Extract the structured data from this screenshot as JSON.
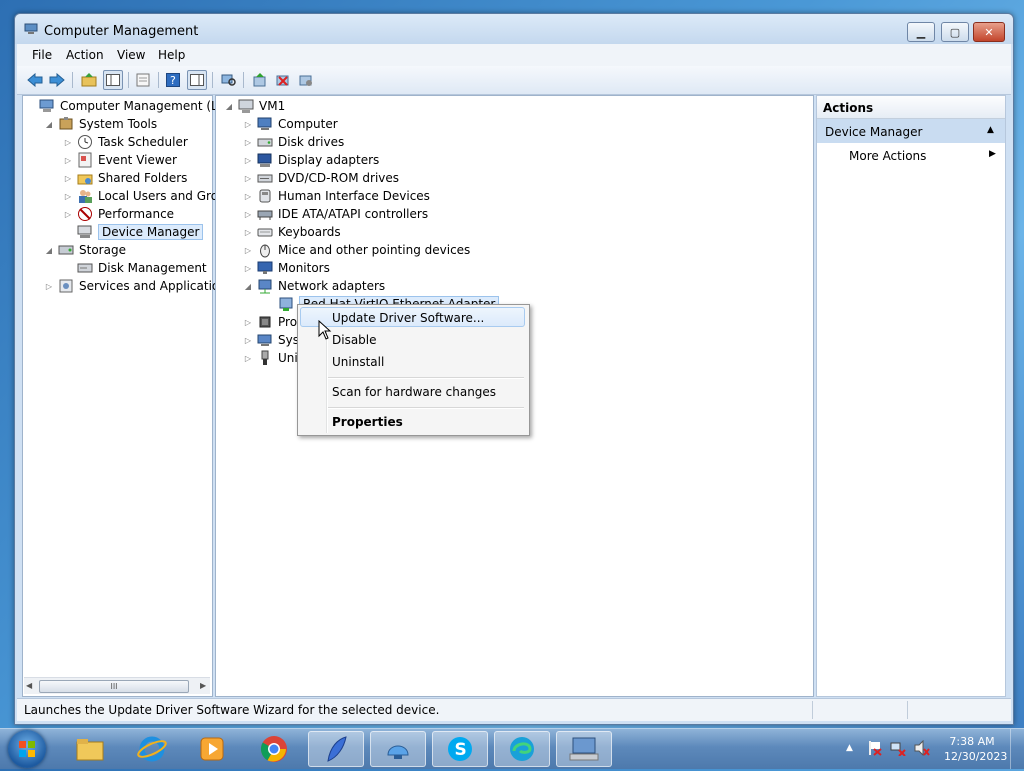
{
  "window": {
    "title": "Computer Management",
    "buttons": {
      "minimize": "▁",
      "maximize": "▢",
      "close": "✕"
    }
  },
  "menu": [
    "File",
    "Action",
    "View",
    "Help"
  ],
  "toolbar_icons": [
    "back-icon",
    "forward-icon",
    "up-folder-icon",
    "show-hide-tree-icon",
    "properties-icon",
    "help-icon",
    "show-hide-action-pane-icon",
    "scan-hardware-icon",
    "update-driver-icon",
    "uninstall-icon",
    "disable-icon"
  ],
  "left_tree": [
    {
      "label": "Computer Management (Local",
      "depth": 0,
      "expander": "",
      "icon": "computer-management-icon"
    },
    {
      "label": "System Tools",
      "depth": 1,
      "expander": "◢",
      "icon": "system-tools-icon"
    },
    {
      "label": "Task Scheduler",
      "depth": 2,
      "expander": "▷",
      "icon": "clock-icon"
    },
    {
      "label": "Event Viewer",
      "depth": 2,
      "expander": "▷",
      "icon": "event-viewer-icon"
    },
    {
      "label": "Shared Folders",
      "depth": 2,
      "expander": "▷",
      "icon": "shared-folder-icon"
    },
    {
      "label": "Local Users and Groups",
      "depth": 2,
      "expander": "▷",
      "icon": "users-icon"
    },
    {
      "label": "Performance",
      "depth": 2,
      "expander": "▷",
      "icon": "performance-icon"
    },
    {
      "label": "Device Manager",
      "depth": 2,
      "expander": "",
      "icon": "device-manager-icon",
      "selected": true
    },
    {
      "label": "Storage",
      "depth": 1,
      "expander": "◢",
      "icon": "storage-icon"
    },
    {
      "label": "Disk Management",
      "depth": 2,
      "expander": "",
      "icon": "disk-management-icon"
    },
    {
      "label": "Services and Applications",
      "depth": 1,
      "expander": "▷",
      "icon": "services-icon"
    }
  ],
  "left_scrollbar": {
    "grip": "III"
  },
  "device_tree": {
    "root": "VM1",
    "items": [
      {
        "label": "Computer",
        "expander": "▷",
        "icon": "computer-icon"
      },
      {
        "label": "Disk drives",
        "expander": "▷",
        "icon": "disk-drive-icon"
      },
      {
        "label": "Display adapters",
        "expander": "▷",
        "icon": "display-adapter-icon"
      },
      {
        "label": "DVD/CD-ROM drives",
        "expander": "▷",
        "icon": "dvd-drive-icon"
      },
      {
        "label": "Human Interface Devices",
        "expander": "▷",
        "icon": "hid-icon"
      },
      {
        "label": "IDE ATA/ATAPI controllers",
        "expander": "▷",
        "icon": "ide-controller-icon"
      },
      {
        "label": "Keyboards",
        "expander": "▷",
        "icon": "keyboard-icon"
      },
      {
        "label": "Mice and other pointing devices",
        "expander": "▷",
        "icon": "mouse-icon"
      },
      {
        "label": "Monitors",
        "expander": "▷",
        "icon": "monitor-icon"
      },
      {
        "label": "Network adapters",
        "expander": "◢",
        "icon": "network-adapter-icon"
      },
      {
        "label": "Red Hat VirtIO Ethernet Adapter",
        "expander": "",
        "icon": "network-card-icon",
        "child": true,
        "selected": true
      },
      {
        "label": "Pro",
        "expander": "▷",
        "icon": "processor-icon"
      },
      {
        "label": "Syst",
        "expander": "▷",
        "icon": "system-devices-icon"
      },
      {
        "label": "Univ",
        "expander": "▷",
        "icon": "usb-icon"
      }
    ]
  },
  "context_menu": {
    "items": [
      "Update Driver Software...",
      "Disable",
      "Uninstall",
      "Scan for hardware changes",
      "Properties"
    ]
  },
  "actions_pane": {
    "header": "Actions",
    "section": "Device Manager",
    "more_actions": "More Actions"
  },
  "status_text": "Launches the Update Driver Software Wizard for the selected device.",
  "taskbar": {
    "apps": [
      "start-orb-icon",
      "file-explorer-icon",
      "internet-explorer-icon",
      "media-player-icon",
      "chrome-icon",
      "app-feather-icon",
      "app-shell-icon",
      "skype-icon",
      "edge-icon",
      "computer-management-taskbar-icon"
    ],
    "time": "7:38 AM",
    "date": "12/30/2023"
  },
  "colors": {
    "accent": "#3a7bc0",
    "selection": "#dcebfc",
    "section_header": "#c9dcf1"
  }
}
